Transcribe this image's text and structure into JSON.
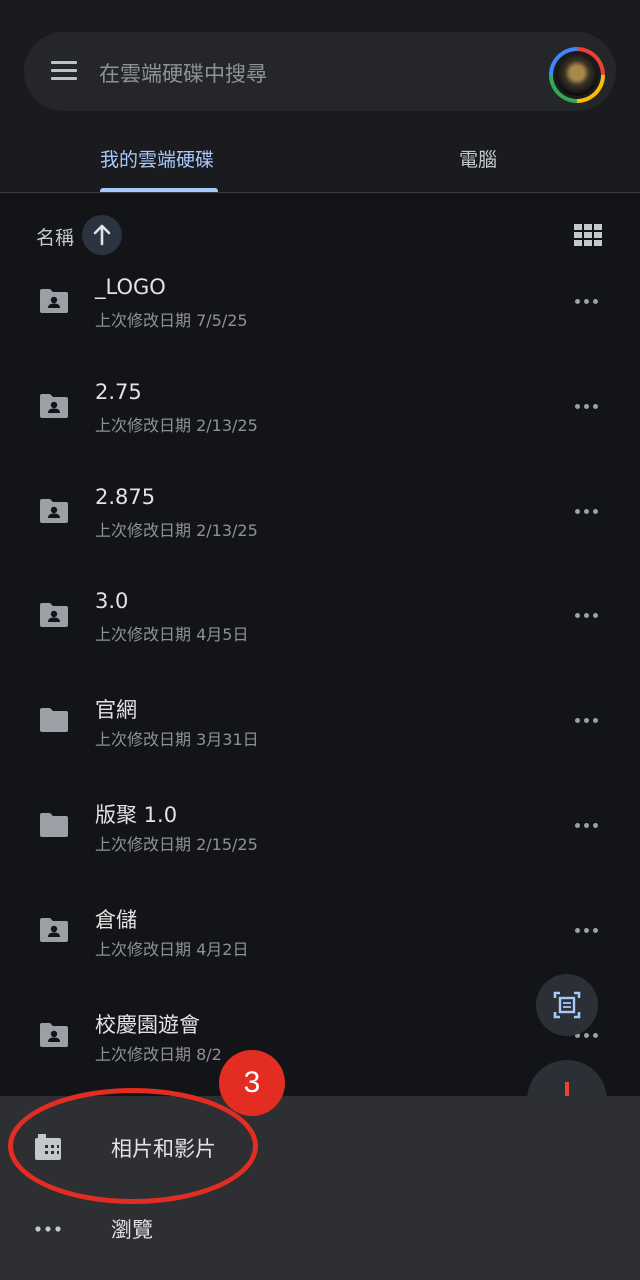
{
  "header": {
    "search_placeholder": "在雲端硬碟中搜尋",
    "menu_icon": "hamburger-menu-icon",
    "avatar_icon": "account-avatar"
  },
  "tabs": [
    {
      "label": "我的雲端硬碟",
      "selected": true
    },
    {
      "label": "電腦",
      "selected": false
    }
  ],
  "sort": {
    "label": "名稱",
    "direction_icon": "arrow-up-icon",
    "view_toggle_icon": "grid-view-icon"
  },
  "files": [
    {
      "name": "_LOGO",
      "modified": "上次修改日期 7/5/25",
      "icon": "shared-folder-icon"
    },
    {
      "name": "2.75",
      "modified": "上次修改日期 2/13/25",
      "icon": "shared-folder-icon"
    },
    {
      "name": "2.875",
      "modified": "上次修改日期 2/13/25",
      "icon": "shared-folder-icon"
    },
    {
      "name": "3.0",
      "modified": "上次修改日期 4月5日",
      "icon": "shared-folder-icon"
    },
    {
      "name": "官網",
      "modified": "上次修改日期 3月31日",
      "icon": "folder-icon"
    },
    {
      "name": "版聚 1.0",
      "modified": "上次修改日期 2/15/25",
      "icon": "folder-icon"
    },
    {
      "name": "倉儲",
      "modified": "上次修改日期 4月2日",
      "icon": "shared-folder-icon"
    },
    {
      "name": "校慶園遊會",
      "modified": "上次修改日期 8/2",
      "icon": "shared-folder-icon"
    }
  ],
  "bottom_sheet": {
    "items": [
      {
        "label": "相片和影片",
        "icon": "photo-library-icon"
      },
      {
        "label": "瀏覽",
        "icon": "more-horizontal-icon"
      }
    ]
  },
  "annotation": {
    "step_number": "3",
    "color": "#e32d22"
  },
  "colors": {
    "background": "#131417",
    "accent": "#a8c7fa",
    "sheet": "#2d2f33"
  }
}
